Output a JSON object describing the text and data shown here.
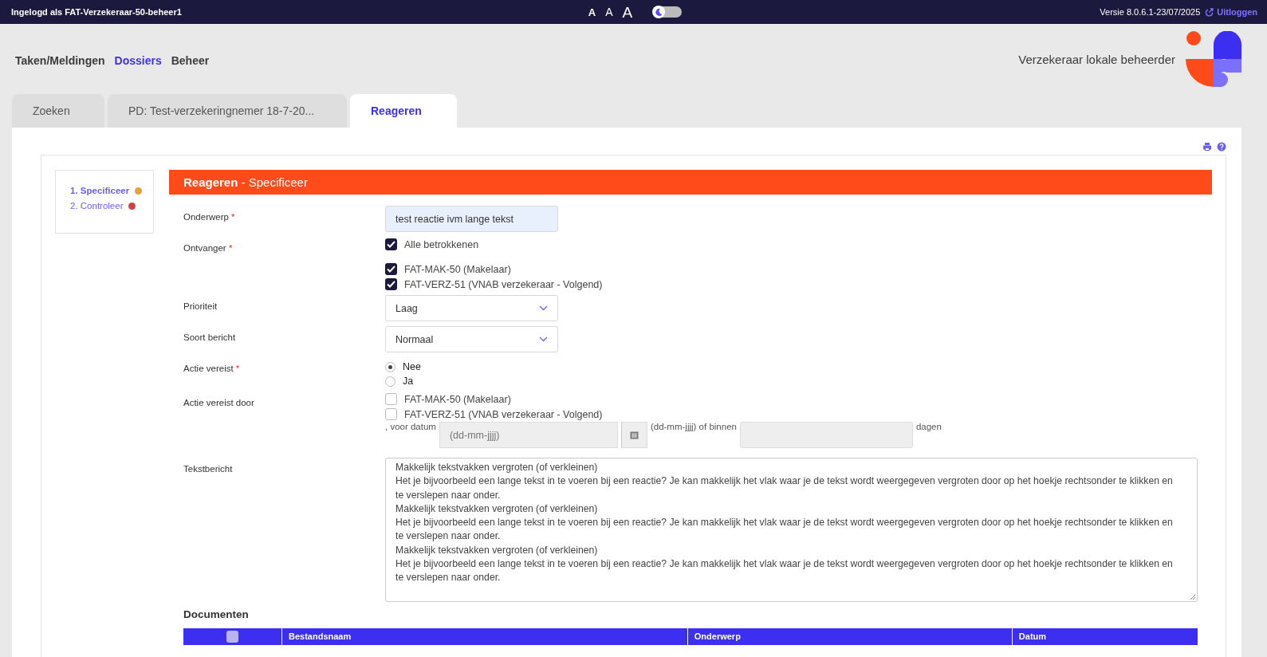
{
  "topbar": {
    "login": "Ingelogd als FAT-Verzekeraar-50-beheer1",
    "font_sizes": [
      {
        "label": "A",
        "selected": false
      },
      {
        "label": "A",
        "selected": false
      },
      {
        "label": "A",
        "selected": false
      }
    ],
    "dark_mode": false,
    "version": "Versie 8.0.6.1-23/07/2025",
    "logout": "Uitloggen"
  },
  "nav": {
    "items": [
      {
        "label": "Taken/Meldingen",
        "selected": false
      },
      {
        "label": "Dossiers",
        "selected": true
      },
      {
        "label": "Beheer",
        "selected": false
      }
    ],
    "role": "Verzekeraar lokale beheerder"
  },
  "tabs": [
    {
      "label": "Zoeken",
      "selected": false
    },
    {
      "label": "PD: Test-verzekeringnemer 18-7-20...",
      "selected": false
    },
    {
      "label": "Reageren",
      "selected": true
    }
  ],
  "steps": [
    {
      "label": "1. Specificeer",
      "selected": true,
      "color": "#e5a23a"
    },
    {
      "label": "2. Controleer",
      "selected": false,
      "color": "#cc4444"
    }
  ],
  "form": {
    "title": "**Reageren** - Specificeer",
    "fields": [
      {
        "kind": "text",
        "label": "Onderwerp",
        "required_mark": "*",
        "value": "test reactie ivm lange tekst"
      },
      {
        "kind": "checkboxes",
        "label": "Ontvanger",
        "required_mark": "*",
        "all": {
          "label": "Alle betrokkenen",
          "checked": true
        },
        "options": [
          {
            "label": "FAT-MAK-50 (Makelaar)",
            "checked": true
          },
          {
            "label": "FAT-VERZ-51 (VNAB verzekeraar - Volgend)",
            "checked": true
          }
        ]
      },
      {
        "kind": "select",
        "label": "Prioriteit",
        "value": "Laag"
      },
      {
        "kind": "select",
        "label": "Soort bericht",
        "value": "Normaal"
      },
      {
        "kind": "radio",
        "label": "Actie vereist",
        "required_mark": "*",
        "options": [
          {
            "label": "Nee",
            "selected": true
          },
          {
            "label": "Ja",
            "selected": false
          }
        ]
      },
      {
        "kind": "checkboxes",
        "label": "Actie vereist door",
        "options": [
          {
            "label": "FAT-MAK-50 (Makelaar)",
            "checked": false
          },
          {
            "label": "FAT-VERZ-51 (VNAB verzekeraar - Volgend)",
            "checked": false
          }
        ]
      },
      {
        "kind": "deadline",
        "before": ", voor datum",
        "placeholder": "(dd-mm-jjjj)",
        "middle": "(dd-mm-jjjj) of binnen",
        "after": "dagen"
      },
      {
        "kind": "textarea",
        "label": "Tekstbericht",
        "lines": [
          "Makkelijk tekstvakken vergroten (of verkleinen)",
          "Het je bijvoorbeeld een lange tekst in te voeren bij een reactie? Je kan makkelijk het vlak waar je de tekst wordt weergegeven vergroten door op het hoekje rechtsonder te klikken en te verslepen naar onder.",
          "Makkelijk tekstvakken vergroten (of verkleinen)",
          "Het je bijvoorbeeld een lange tekst in te voeren bij een reactie? Je kan makkelijk het vlak waar je de tekst wordt weergegeven vergroten door op het hoekje rechtsonder te klikken en te verslepen naar onder.",
          "Makkelijk tekstvakken vergroten (of verkleinen)",
          "Het je bijvoorbeeld een lange tekst in te voeren bij een reactie? Je kan makkelijk het vlak waar je de tekst wordt weergegeven vergroten door op het hoekje rechtsonder te klikken en te verslepen naar onder."
        ]
      }
    ]
  },
  "documents": {
    "title": "Documenten",
    "select_all_checked": false,
    "columns": [
      "Bestandsnaam",
      "Onderwerp",
      "Datum"
    ]
  }
}
